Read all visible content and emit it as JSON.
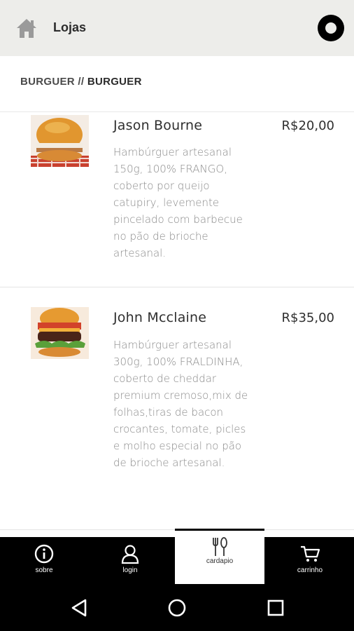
{
  "header": {
    "title": "Lojas"
  },
  "breadcrumb": {
    "category": "BURGUER",
    "separator": "//",
    "current": "BURGUER"
  },
  "products": [
    {
      "name": "Jason Bourne",
      "price": "R$20,00",
      "description": "Hambúrguer artesanal 150g, 100% FRANGO, coberto por queijo catupiry, levemente pincelado com barbecue no pão de brioche artesanal."
    },
    {
      "name": "John Mcclaine",
      "price": "R$35,00",
      "description": "Hambúrguer artesanal 300g, 100% FRALDINHA, coberto de cheddar premium cremoso,mix de folhas,tiras de bacon crocantes, tomate, picles e molho especial no pão de brioche artesanal."
    }
  ],
  "bottom_nav": {
    "items": [
      {
        "label": "sobre",
        "icon": "info-icon"
      },
      {
        "label": "login",
        "icon": "user-icon"
      },
      {
        "label": "cardapio",
        "icon": "cutlery-icon",
        "active": true
      },
      {
        "label": "carrinho",
        "icon": "cart-icon"
      }
    ]
  },
  "android_nav": {
    "icons": [
      "back-icon",
      "home-icon",
      "recents-icon"
    ]
  },
  "colors": {
    "header_bg": "#ededea",
    "nav_bg": "#000000",
    "text_muted": "#8a8a8a"
  }
}
